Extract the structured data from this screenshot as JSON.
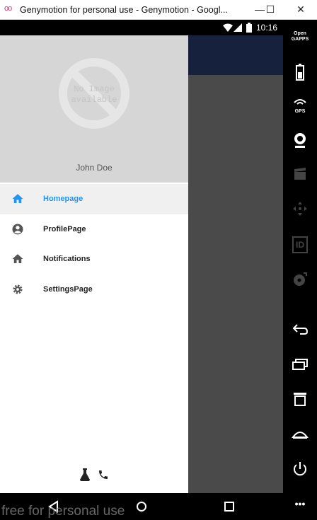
{
  "window": {
    "title": "Genymotion for personal use - Genymotion - Googl...",
    "logo": "oo",
    "minimize_label": "—",
    "maximize_label": "☐",
    "close_label": "✕"
  },
  "statusbar": {
    "time": "10:16"
  },
  "drawer": {
    "header": {
      "image_placeholder_line1": "No Image",
      "image_placeholder_line2": "available",
      "user_name": "John Doe"
    },
    "items": [
      {
        "label": "Homepage",
        "icon": "home-icon",
        "active": true
      },
      {
        "label": "ProfilePage",
        "icon": "account-circle-icon",
        "active": false
      },
      {
        "label": "Notifications",
        "icon": "home-icon",
        "active": false
      },
      {
        "label": "SettingsPage",
        "icon": "gear-icon",
        "active": false
      }
    ],
    "footer_icons": [
      "flask-icon",
      "phone-icon"
    ]
  },
  "sidebar": {
    "open_gapps_line1": "Open",
    "open_gapps_line2": "GAPPS",
    "gps_label": "GPS",
    "id_label": "ID",
    "more_label": "•••"
  },
  "watermark": "free for personal use",
  "colors": {
    "accent": "#2196f3",
    "appbar": "#16213e",
    "drawer_header": "#d6d6d6"
  }
}
